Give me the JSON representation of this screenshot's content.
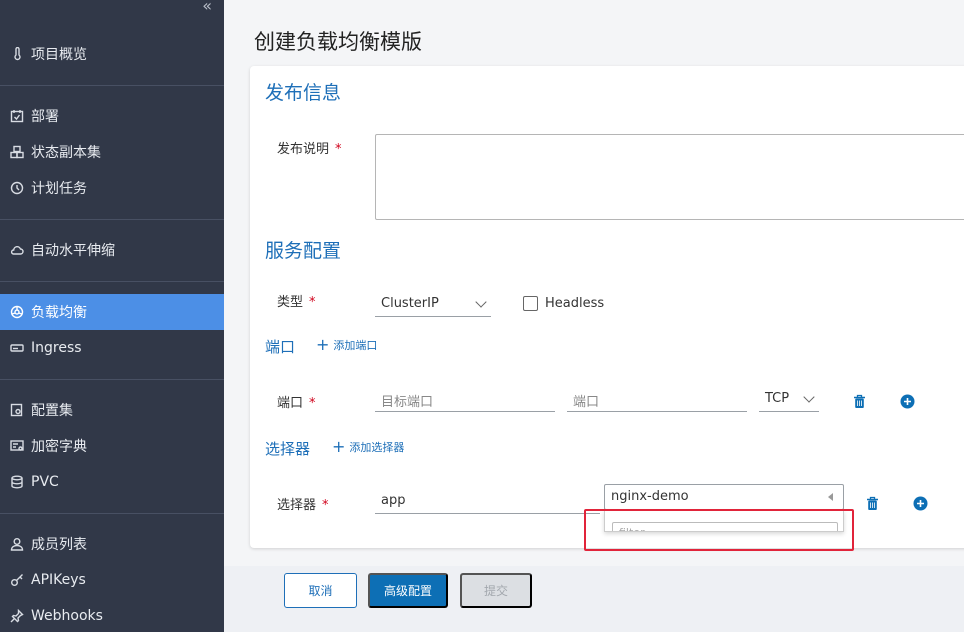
{
  "sidebar": {
    "items": [
      {
        "label": "项目概览",
        "icon": "thermometer-icon"
      },
      {
        "label": "部署",
        "icon": "calendar-check-icon"
      },
      {
        "label": "状态副本集",
        "icon": "cubes-icon"
      },
      {
        "label": "计划任务",
        "icon": "clock-icon"
      },
      {
        "label": "自动水平伸缩",
        "icon": "cloud-icon"
      },
      {
        "label": "负载均衡",
        "icon": "network-icon"
      },
      {
        "label": "Ingress",
        "icon": "hard-drive-icon"
      },
      {
        "label": "配置集",
        "icon": "gear-file-icon"
      },
      {
        "label": "加密字典",
        "icon": "key-list-icon"
      },
      {
        "label": "PVC",
        "icon": "database-icon"
      },
      {
        "label": "成员列表",
        "icon": "user-icon"
      },
      {
        "label": "APIKeys",
        "icon": "key-icon"
      },
      {
        "label": "Webhooks",
        "icon": "pin-icon"
      }
    ],
    "active": "负载均衡",
    "active_color": "#4c8fe6"
  },
  "page": {
    "title": "创建负载均衡模版"
  },
  "release": {
    "section_title": "发布信息",
    "desc_label": "发布说明",
    "required_mark": "*"
  },
  "service": {
    "section_title": "服务配置",
    "type_label": "类型",
    "type_value": "ClusterIP",
    "headless_label": "Headless"
  },
  "ports": {
    "title": "端口",
    "add_label": "添加端口",
    "row_label": "端口",
    "target_port_placeholder": "目标端口",
    "port_placeholder": "端口",
    "protocol_value": "TCP"
  },
  "selectors": {
    "title": "选择器",
    "add_label": "添加选择器",
    "row_label": "选择器",
    "key_value": "app",
    "value_selected": "nginx-demo",
    "filter_placeholder": "filter"
  },
  "footer": {
    "cancel_label": "取消",
    "advanced_label": "高级配置",
    "submit_label": "提交"
  },
  "colors": {
    "accent": "#1e6fb8",
    "required": "#d0021b",
    "highlight": "#e1243a"
  }
}
